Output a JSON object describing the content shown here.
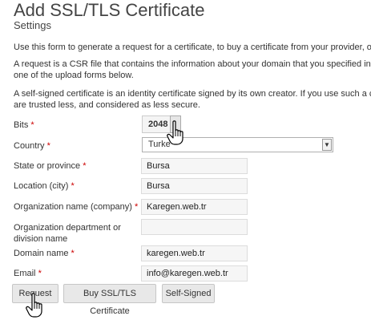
{
  "header": {
    "title": "Add SSL/TLS Certificate",
    "subtitle": "Settings"
  },
  "intro": {
    "p1": "Use this form to generate a request for a certificate, to buy a certificate from your provider, or to g",
    "p2_line1": "A request is a CSR file that contains the information about your domain that you specified in the fo",
    "p2_line2": "one of the upload forms below.",
    "p3_line1": "A self-signed certificate is an identity certificate signed by its own creator. If you use such a certifica",
    "p3_line2": "are trusted less, and considered as less secure."
  },
  "form": {
    "required_mark": "*",
    "bits": {
      "label": "Bits",
      "value": "2048"
    },
    "country": {
      "label": "Country",
      "value": "Turke"
    },
    "state": {
      "label": "State or province",
      "value": "Bursa"
    },
    "location": {
      "label": "Location (city)",
      "value": "Bursa"
    },
    "organization": {
      "label": "Organization name (company)",
      "value": "Karegen.web.tr"
    },
    "department": {
      "label_line1": "Organization department or",
      "label_line2": "division name",
      "value": ""
    },
    "domain": {
      "label": "Domain name",
      "value": "karegen.web.tr"
    },
    "email": {
      "label": "Email",
      "value": "info@karegen.web.tr"
    }
  },
  "buttons": {
    "request": "Request",
    "buy": "Buy SSL/TLS Certificate",
    "self_signed": "Self-Signed"
  },
  "icons": {
    "cursor": "hand-pointer-icon",
    "dropdown": "chevron-down-icon"
  }
}
